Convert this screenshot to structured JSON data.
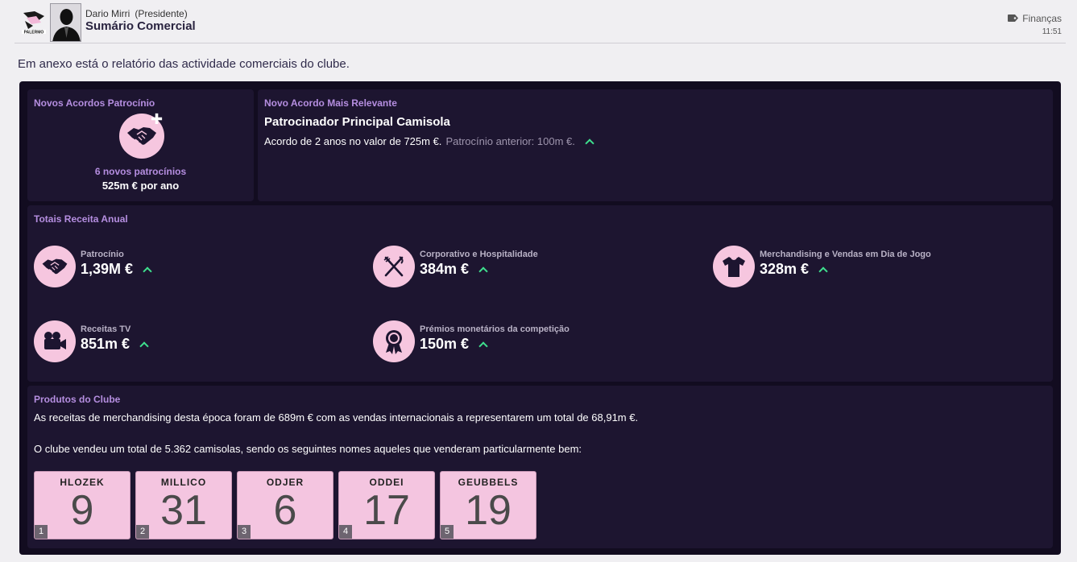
{
  "header": {
    "sender_name": "Dario Mirri",
    "sender_role": "(Presidente)",
    "subject": "Sumário Comercial",
    "category": "Finanças",
    "time": "11:51",
    "club_logo_text": "PALERMO"
  },
  "intro": "Em anexo está o relatório das actividade comerciais do clube.",
  "sponsors": {
    "title": "Novos Acordos Patrocínio",
    "count_text": "6 novos patrocínios",
    "total_text": "525m € por ano"
  },
  "deal": {
    "title": "Novo Acordo Mais Relevante",
    "name": "Patrocinador Principal Camisola",
    "description": "Acordo de 2 anos no valor de 725m €.",
    "previous": "Patrocínio anterior: 100m €.",
    "trend": "up"
  },
  "revenue": {
    "title": "Totais Receita Anual",
    "items": [
      {
        "label": "Patrocínio",
        "value": "1,39M €",
        "icon": "handshake-icon",
        "trend": "up"
      },
      {
        "label": "Corporativo e Hospitalidade",
        "value": "384m €",
        "icon": "cutlery-icon",
        "trend": "up"
      },
      {
        "label": "Merchandising e Vendas em Dia de Jogo",
        "value": "328m €",
        "icon": "shirt-icon",
        "trend": "up"
      },
      {
        "label": "Receitas TV",
        "value": "851m €",
        "icon": "camera-icon",
        "trend": "up"
      },
      {
        "label": "Prémios monetários da competição",
        "value": "150m €",
        "icon": "award-icon",
        "trend": "up"
      }
    ]
  },
  "products": {
    "title": "Produtos do Clube",
    "text1": "As receitas de merchandising desta época foram de 689m € com as vendas internacionais a representarem um total de 68,91m €.",
    "text2": "O clube vendeu um total de 5.362 camisolas, sendo os seguintes nomes aqueles que venderam particularmente bem:",
    "shirts": [
      {
        "rank": "1",
        "name": "HLOZEK",
        "number": "9"
      },
      {
        "rank": "2",
        "name": "MILLICO",
        "number": "31"
      },
      {
        "rank": "3",
        "name": "ODJER",
        "number": "6"
      },
      {
        "rank": "4",
        "name": "ODDEI",
        "number": "17"
      },
      {
        "rank": "5",
        "name": "GEUBBELS",
        "number": "19"
      }
    ]
  },
  "colors": {
    "accent": "#b58ee0",
    "panel": "#120c20",
    "card": "#1d1530",
    "icon_bg": "#f6c6df",
    "trend_up": "#3ee08e"
  }
}
